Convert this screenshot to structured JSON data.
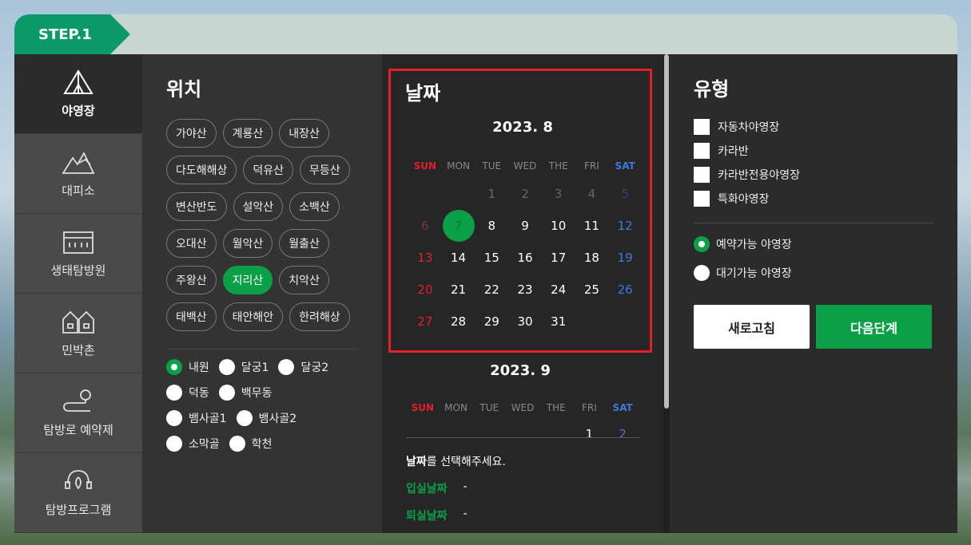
{
  "step": "STEP.1",
  "sidebar": {
    "items": [
      {
        "label": "야영장",
        "icon": "tent-icon"
      },
      {
        "label": "대피소",
        "icon": "mountain-shelter-icon"
      },
      {
        "label": "생태탐방원",
        "icon": "building-icon"
      },
      {
        "label": "민박촌",
        "icon": "houses-icon"
      },
      {
        "label": "탐방로 예약제",
        "icon": "trail-pin-icon"
      },
      {
        "label": "탐방프로그램",
        "icon": "guide-headset-icon"
      }
    ]
  },
  "location": {
    "title": "위치",
    "chips": [
      "가야산",
      "계룡산",
      "내장산",
      "다도해해상",
      "덕유산",
      "무등산",
      "변산반도",
      "설악산",
      "소백산",
      "오대산",
      "월악산",
      "월출산",
      "주왕산",
      "지리산",
      "치악산",
      "태백산",
      "태안해안",
      "한려해상"
    ],
    "selected_chip": "지리산",
    "radios": [
      [
        "내원",
        "달궁1",
        "달궁2"
      ],
      [
        "덕동",
        "백무동"
      ],
      [
        "뱀사골1",
        "뱀사골2"
      ],
      [
        "소막골",
        "학천"
      ]
    ],
    "selected_radio": "내원"
  },
  "date": {
    "title": "날짜",
    "weekdays": [
      "SUN",
      "MON",
      "TUE",
      "WED",
      "THE",
      "FRI",
      "SAT"
    ],
    "aug": {
      "label": "2023. 8",
      "rows": [
        [
          "",
          "",
          "1",
          "2",
          "3",
          "4",
          "5"
        ],
        [
          "6",
          "7",
          "8",
          "9",
          "10",
          "11",
          "12"
        ],
        [
          "13",
          "14",
          "15",
          "16",
          "17",
          "18",
          "19"
        ],
        [
          "20",
          "21",
          "22",
          "23",
          "24",
          "25",
          "26"
        ],
        [
          "27",
          "28",
          "29",
          "30",
          "31",
          "",
          ""
        ]
      ],
      "today": "7"
    },
    "sep": {
      "label": "2023. 9",
      "first_row": [
        "",
        "",
        "",
        "",
        "",
        "1",
        "2"
      ]
    },
    "hint_bold": "날짜",
    "hint_rest": "를 선택해주세요.",
    "checkin_label": "입실날짜",
    "checkin_value": "-",
    "checkout_label": "퇴실날짜",
    "checkout_value": "-"
  },
  "type": {
    "title": "유형",
    "checks": [
      "자동차야영장",
      "카라반",
      "카라반전용야영장",
      "특화야영장"
    ],
    "radios": [
      "예약가능 야영장",
      "대기가능 야영장"
    ],
    "selected_radio": "예약가능 야영장",
    "refresh_label": "새로고침",
    "next_label": "다음단계"
  },
  "colors": {
    "accent": "#0aa046",
    "step": "#0a9a6a",
    "highlight": "#e0212b"
  }
}
